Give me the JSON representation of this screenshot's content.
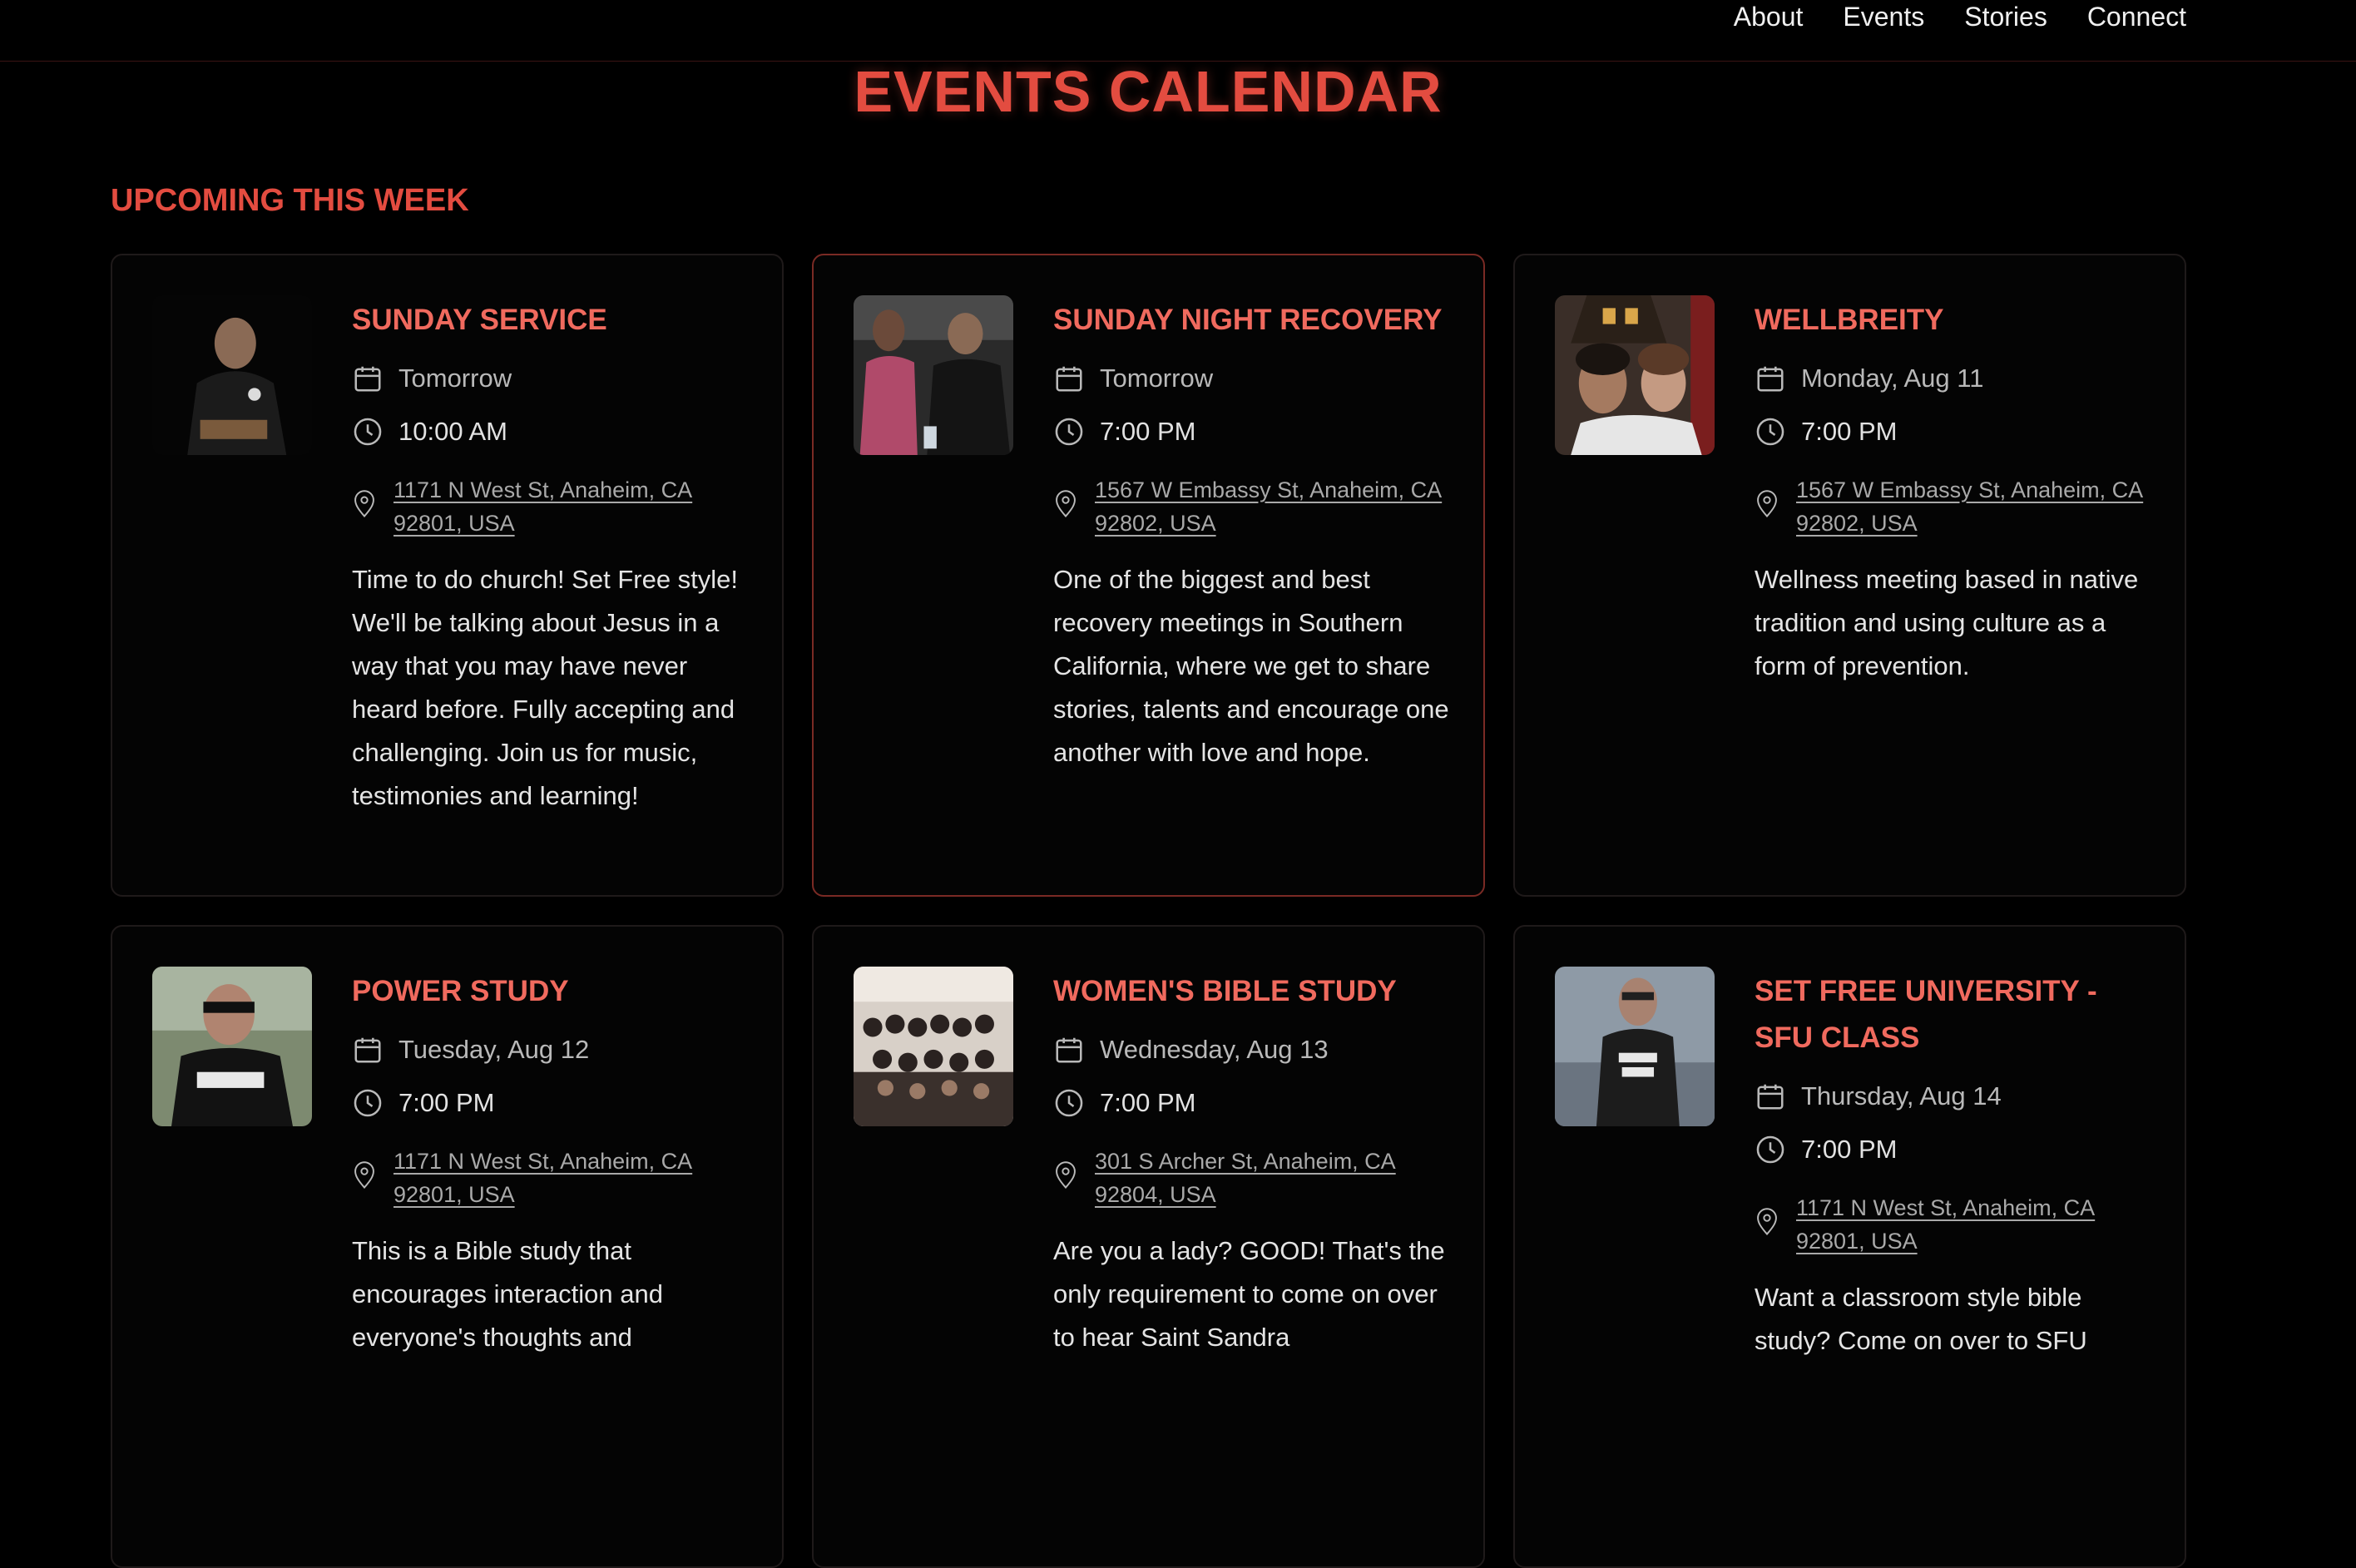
{
  "nav": {
    "items": [
      "About",
      "Events",
      "Stories",
      "Connect"
    ]
  },
  "page_title": "EVENTS CALENDAR",
  "section_title": "UPCOMING THIS WEEK",
  "colors": {
    "accent": "#e34c40",
    "event_title": "#f06a5e",
    "background": "#000000"
  },
  "events": [
    {
      "title": "SUNDAY SERVICE",
      "date": "Tomorrow",
      "time": "10:00 AM",
      "address": "1171 N West St, Anaheim, CA 92801, USA",
      "description": "Time to do church! Set Free style! We'll be talking about Jesus in a way that you may have never heard before. Fully accepting and challenging. Join us for music, testimonies and learning!",
      "image": "man-seated-with-guitar-photo"
    },
    {
      "title": "SUNDAY NIGHT RECOVERY",
      "date": "Tomorrow",
      "time": "7:00 PM",
      "address": "1567 W Embassy St, Anaheim, CA 92802, USA",
      "description": "One of the biggest and best recovery meetings in Southern California, where we get to share stories, talents and encourage one another with love and hope.",
      "image": "two-people-photo"
    },
    {
      "title": "WELLBREITY",
      "date": "Monday, Aug 11",
      "time": "7:00 PM",
      "address": "1567 W Embassy St, Anaheim, CA 92802, USA",
      "description": "Wellness meeting based in native tradition and using culture as a form of prevention.",
      "image": "two-women-selfie-photo"
    },
    {
      "title": "POWER STUDY",
      "date": "Tuesday, Aug 12",
      "time": "7:00 PM",
      "address": "1171 N West St, Anaheim, CA 92801, USA",
      "description": "This is a Bible study that encourages interaction and everyone's thoughts and",
      "image": "man-in-soldier-shirt-photo"
    },
    {
      "title": "WOMEN'S BIBLE STUDY",
      "date": "Wednesday, Aug 13",
      "time": "7:00 PM",
      "address": "301 S Archer St, Anaheim, CA 92804, USA",
      "description": "Are you a lady? GOOD! That's the only requirement to come on over to hear Saint Sandra",
      "image": "group-of-women-photo"
    },
    {
      "title": "SET FREE UNIVERSITY - SFU CLASS",
      "date": "Thursday, Aug 14",
      "time": "7:00 PM",
      "address": "1171 N West St, Anaheim, CA 92801, USA",
      "description": "Want a classroom style bible study? Come on over to SFU",
      "image": "man-in-bible-nerd-shirt-photo"
    }
  ]
}
